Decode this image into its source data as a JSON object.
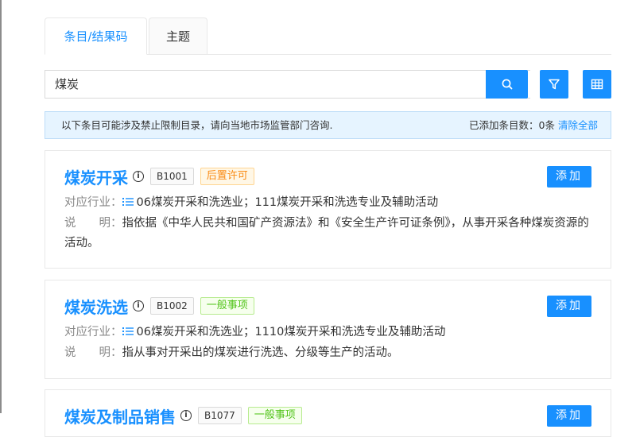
{
  "tabs": [
    {
      "label": "条目/结果码",
      "active": true
    },
    {
      "label": "主题",
      "active": false
    }
  ],
  "search": {
    "value": "煤炭"
  },
  "icons": {
    "search": "search-icon",
    "filter": "filter-icon",
    "grid": "table-grid-icon",
    "info": "info-icon",
    "list": "list-icon"
  },
  "colors": {
    "accent": "#1890ff",
    "tag_orange": "#fa8c16",
    "tag_green": "#52c41a"
  },
  "notice": {
    "text": "以下条目可能涉及禁止限制目录，请向当地市场监管部门咨询.",
    "count_label": "已添加条目数：0条",
    "clear_link": "清除全部"
  },
  "items": [
    {
      "title": "煤炭开采",
      "code": "B1001",
      "tag": "后置许可",
      "add_label": "添加",
      "industry_label": "对应行业：",
      "industry_text": "06煤炭开采和洗选业；111煤炭开采和洗选专业及辅助活动",
      "desc_label": "说　　明：",
      "desc_text": "指依据《中华人民共和国矿产资源法》和《安全生产许可证条例》，从事开采各种煤炭资源的活动。"
    },
    {
      "title": "煤炭洗选",
      "code": "B1002",
      "tag": "一般事项",
      "add_label": "添加",
      "industry_label": "对应行业：",
      "industry_text": "06煤炭开采和洗选业；1110煤炭开采和洗选专业及辅助活动",
      "desc_label": "说　　明：",
      "desc_text": "指从事对开采出的煤炭进行洗选、分级等生产的活动。"
    },
    {
      "title": "煤炭及制品销售",
      "code": "B1077",
      "tag": "一般事项",
      "add_label": "添加"
    }
  ]
}
